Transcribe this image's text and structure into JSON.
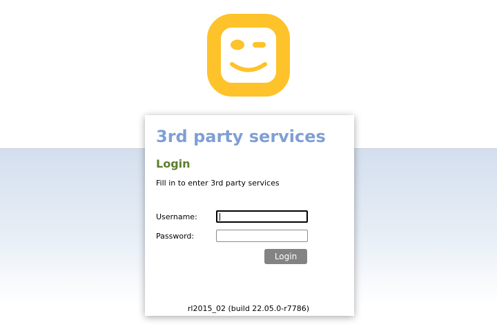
{
  "brand": {
    "logo_icon": "winking-smiley-logo-icon",
    "logo_color": "#fec22a"
  },
  "panel": {
    "title": "3rd party services",
    "subtitle": "Login",
    "description": "Fill in to enter 3rd party services"
  },
  "form": {
    "username_label": "Username:",
    "username_value": "",
    "password_label": "Password:",
    "password_value": "",
    "login_label": "Login"
  },
  "footer": {
    "version": "rl2015_02 (build 22.05.0-r7786)"
  },
  "colors": {
    "title": "#7f9fd4",
    "subtitle": "#5e7d2c",
    "button": "#838383"
  }
}
